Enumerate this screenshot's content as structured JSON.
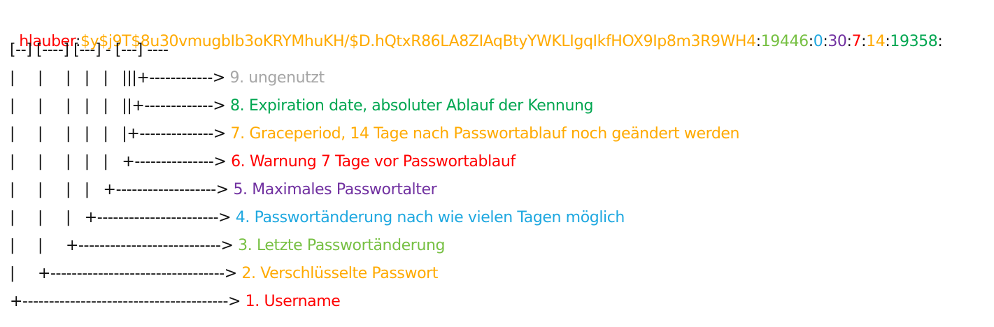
{
  "shadow_entry": {
    "segments": [
      {
        "text": "hlauber",
        "color": "#ff0000"
      },
      {
        "text": ":",
        "color": "#111111"
      },
      {
        "text": "$y$j9T$8u30vmugbIb3oKRYMhuKH/$D.hQtxR86LA8ZIAqBtyYWKLIgqIkfHOX9Ip8m3R9WH4",
        "color": "#ffaa00"
      },
      {
        "text": ":",
        "color": "#111111"
      },
      {
        "text": "19446",
        "color": "#77c043"
      },
      {
        "text": ":",
        "color": "#111111"
      },
      {
        "text": "0",
        "color": "#1fa8e0"
      },
      {
        "text": ":",
        "color": "#111111"
      },
      {
        "text": "30",
        "color": "#7030a0"
      },
      {
        "text": ":",
        "color": "#111111"
      },
      {
        "text": "7",
        "color": "#ff0000"
      },
      {
        "text": ":",
        "color": "#111111"
      },
      {
        "text": "14",
        "color": "#ffaa00"
      },
      {
        "text": ":",
        "color": "#111111"
      },
      {
        "text": "19358",
        "color": "#00a650"
      },
      {
        "text": ":",
        "color": "#111111"
      }
    ]
  },
  "bracket_line": "[--] [----] [---] - [---] ----",
  "annotations": [
    {
      "prefix": "|     |     |   |   |   |||+------------> ",
      "label": "9. ungenutzt",
      "color": "#a6a6a6"
    },
    {
      "prefix": "|     |     |   |   |   ||+-------------> ",
      "label": "8. Expiration date, absoluter Ablauf der Kennung",
      "color": "#00a650"
    },
    {
      "prefix": "|     |     |   |   |   |+--------------> ",
      "label": "7. Graceperiod, 14 Tage nach Passwortablauf noch geändert werden",
      "color": "#ffaa00"
    },
    {
      "prefix": "|     |     |   |   |   +---------------> ",
      "label": "6. Warnung 7 Tage vor Passwortablauf",
      "color": "#ff0000"
    },
    {
      "prefix": "|     |     |   |   +-------------------> ",
      "label": "5. Maximales Passwortalter",
      "color": "#7030a0"
    },
    {
      "prefix": "|     |     |   +-----------------------> ",
      "label": "4. Passwortänderung nach wie vielen Tagen möglich",
      "color": "#1fa8e0"
    },
    {
      "prefix": "|     |     +---------------------------> ",
      "label": "3. Letzte Passwortänderung",
      "color": "#77c043"
    },
    {
      "prefix": "|     +---------------------------------> ",
      "label": "2. Verschlüsselte Passwort",
      "color": "#ffaa00"
    },
    {
      "prefix": "+---------------------------------------> ",
      "label": "1. Username",
      "color": "#ff0000"
    }
  ]
}
